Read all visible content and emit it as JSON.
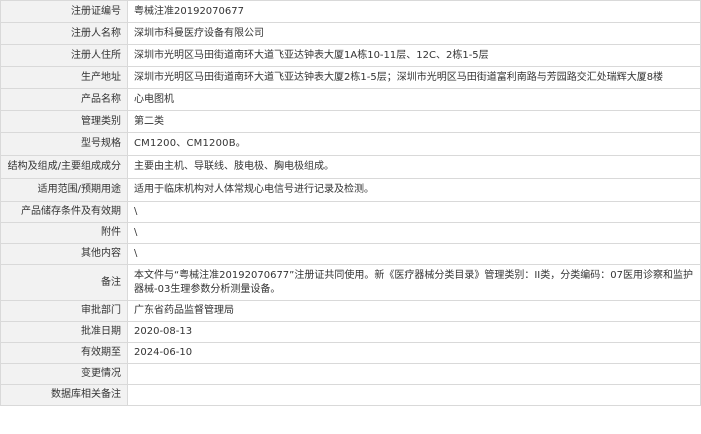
{
  "rows": [
    {
      "label": "注册证编号",
      "value": "粤械注准20192070677"
    },
    {
      "label": "注册人名称",
      "value": "深圳市科曼医疗设备有限公司"
    },
    {
      "label": "注册人住所",
      "value": "深圳市光明区马田街道南环大道飞亚达钟表大厦1A栋10-11层、12C、2栋1-5层"
    },
    {
      "label": "生产地址",
      "value": "深圳市光明区马田街道南环大道飞亚达钟表大厦2栋1-5层；深圳市光明区马田街道富利南路与芳园路交汇处瑞辉大厦8楼"
    },
    {
      "label": "产品名称",
      "value": "心电图机"
    },
    {
      "label": "管理类别",
      "value": "第二类"
    },
    {
      "label": "型号规格",
      "value": "CM1200、CM1200B。"
    },
    {
      "label": "结构及组成/主要组成成分",
      "value": "主要由主机、导联线、肢电极、胸电极组成。"
    },
    {
      "label": "适用范围/预期用途",
      "value": "适用于临床机构对人体常规心电信号进行记录及检测。"
    },
    {
      "label": "产品储存条件及有效期",
      "value": "\\"
    },
    {
      "label": "附件",
      "value": "\\"
    },
    {
      "label": "其他内容",
      "value": "\\"
    },
    {
      "label": "备注",
      "value": "本文件与“粤械注准20192070677”注册证共同使用。新《医疗器械分类目录》管理类别：II类，分类编码：07医用诊察和监护器械-03生理参数分析测量设备。"
    },
    {
      "label": "审批部门",
      "value": "广东省药品监督管理局"
    },
    {
      "label": "批准日期",
      "value": "2020-08-13"
    },
    {
      "label": "有效期至",
      "value": "2024-06-10"
    },
    {
      "label": "变更情况",
      "value": ""
    },
    {
      "label": "数据库相关备注",
      "value": ""
    }
  ]
}
